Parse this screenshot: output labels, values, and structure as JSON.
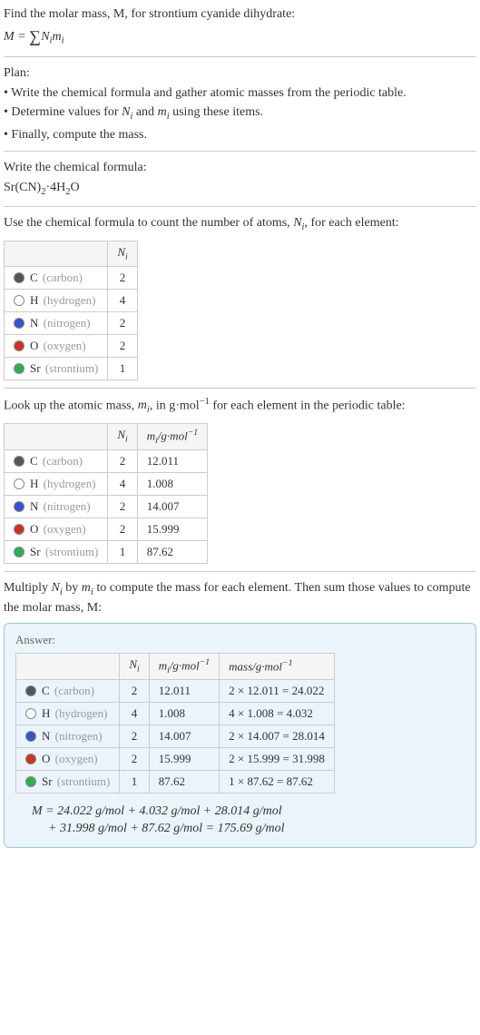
{
  "intro": {
    "title_line": "Find the molar mass, M, for strontium cyanide dihydrate:",
    "formula_prefix": "M = ",
    "formula_sum_var": "N",
    "formula_sum_idx": "i",
    "formula_sum_m": "m"
  },
  "plan": {
    "heading": "Plan:",
    "item1": "• Write the chemical formula and gather atomic masses from the periodic table.",
    "item2_prefix": "• Determine values for ",
    "item2_mid": " and ",
    "item2_suffix": " using these items.",
    "item3": "• Finally, compute the mass."
  },
  "formula_section": {
    "heading": "Write the chemical formula:",
    "formula_html": "Sr(CN)",
    "dot": "·4H",
    "o_part": "O"
  },
  "count_section": {
    "heading_prefix": "Use the chemical formula to count the number of atoms, ",
    "heading_suffix": ", for each element:"
  },
  "lookup_section": {
    "heading_prefix": "Look up the atomic mass, ",
    "heading_mid": ", in g·mol",
    "heading_suffix": " for each element in the periodic table:"
  },
  "multiply_section": {
    "heading_prefix": "Multiply ",
    "heading_mid": " by ",
    "heading_suffix": " to compute the mass for each element. Then sum those values to compute the molar mass, M:"
  },
  "headers": {
    "ni": "N",
    "ni_sub": "i",
    "mi": "m",
    "mi_sub": "i",
    "mi_unit": "/g·mol",
    "neg1": "−1",
    "mass": "mass/g·mol"
  },
  "elements": [
    {
      "sym": "C",
      "name": "(carbon)",
      "swatch": "c",
      "n": "2",
      "m": "12.011",
      "mass": "2 × 12.011 = 24.022"
    },
    {
      "sym": "H",
      "name": "(hydrogen)",
      "swatch": "h",
      "n": "4",
      "m": "1.008",
      "mass": "4 × 1.008 = 4.032"
    },
    {
      "sym": "N",
      "name": "(nitrogen)",
      "swatch": "n",
      "n": "2",
      "m": "14.007",
      "mass": "2 × 14.007 = 28.014"
    },
    {
      "sym": "O",
      "name": "(oxygen)",
      "swatch": "o",
      "n": "2",
      "m": "15.999",
      "mass": "2 × 15.999 = 31.998"
    },
    {
      "sym": "Sr",
      "name": "(strontium)",
      "swatch": "sr",
      "n": "1",
      "m": "87.62",
      "mass": "1 × 87.62 = 87.62"
    }
  ],
  "answer": {
    "label": "Answer:",
    "final_line1": "M = 24.022 g/mol + 4.032 g/mol + 28.014 g/mol",
    "final_line2": "+ 31.998 g/mol + 87.62 g/mol = 175.69 g/mol"
  }
}
